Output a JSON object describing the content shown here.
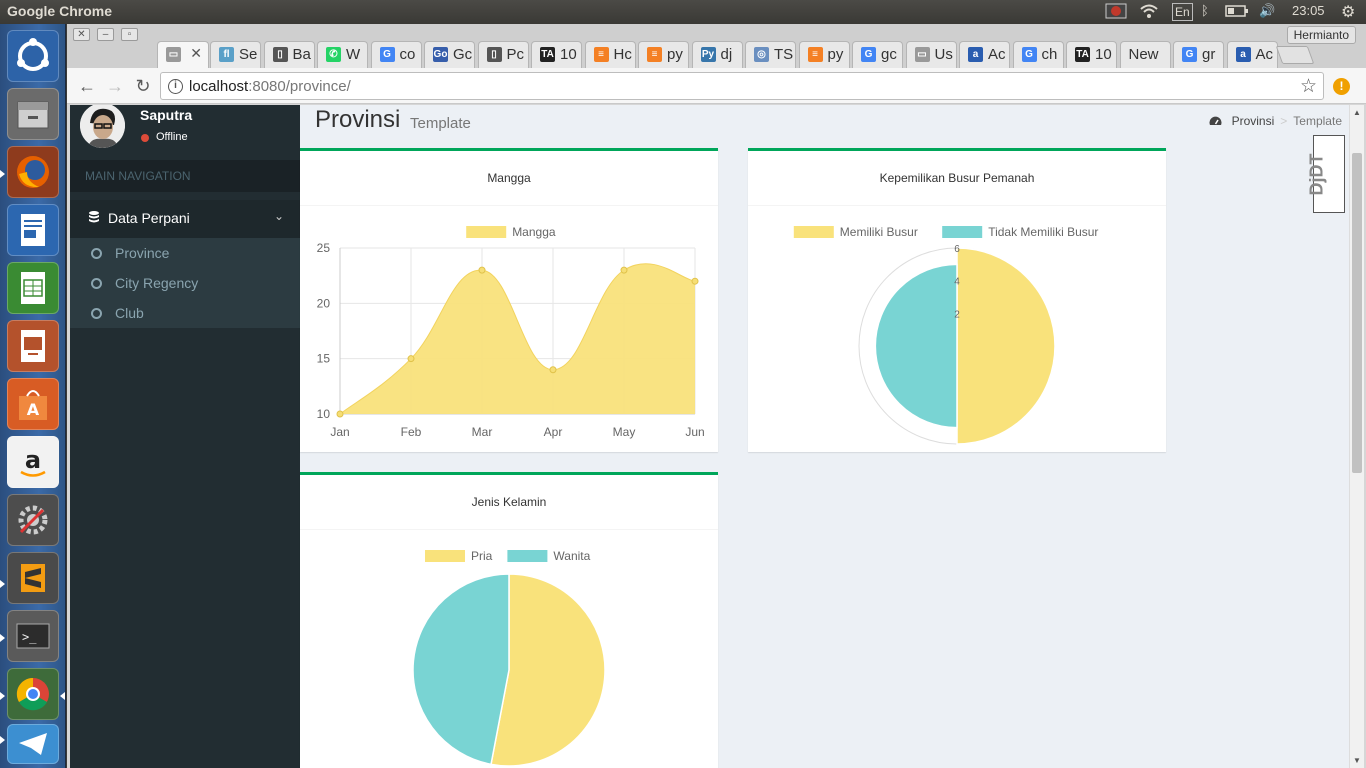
{
  "top_panel": {
    "app_name": "Google Chrome",
    "keyboard": "En",
    "time": "23:05"
  },
  "launcher": {
    "items": [
      "ubuntu-dash-icon",
      "files-icon",
      "firefox-icon",
      "writer-icon",
      "calc-icon",
      "impress-icon",
      "software-center-icon",
      "amazon-icon",
      "system-settings-icon",
      "sublime-icon",
      "terminal-icon",
      "chrome-icon",
      "telegram-icon"
    ]
  },
  "browser": {
    "profile": "Hermianto",
    "tabs": [
      {
        "label": "",
        "icon": "page-icon",
        "active": true
      },
      {
        "label": "Se",
        "icon": "fl-icon"
      },
      {
        "label": "Ba",
        "icon": "book-icon"
      },
      {
        "label": "W",
        "icon": "whatsapp-icon"
      },
      {
        "label": "co",
        "icon": "google-icon"
      },
      {
        "label": "Gc",
        "icon": "go-icon"
      },
      {
        "label": "Pc",
        "icon": "book-icon"
      },
      {
        "label": "10",
        "icon": "ta-icon"
      },
      {
        "label": "Hc",
        "icon": "stackoverflow-icon"
      },
      {
        "label": "py",
        "icon": "stackoverflow-icon"
      },
      {
        "label": "dj",
        "icon": "python-icon"
      },
      {
        "label": "TS",
        "icon": "seal-icon"
      },
      {
        "label": "py",
        "icon": "stackoverflow-icon"
      },
      {
        "label": "gc",
        "icon": "google-icon"
      },
      {
        "label": "Us",
        "icon": "page-icon"
      },
      {
        "label": "Ac",
        "icon": "a-icon"
      },
      {
        "label": "ch",
        "icon": "google-icon"
      },
      {
        "label": "10",
        "icon": "ta-icon"
      },
      {
        "label": "New",
        "icon": ""
      },
      {
        "label": "gr",
        "icon": "google-icon"
      },
      {
        "label": "Ac",
        "icon": "a-icon"
      }
    ],
    "url_host": "localhost",
    "url_rest": ":8080/province/"
  },
  "sidebar": {
    "user_name": "Saputra",
    "user_status": "Offline",
    "nav_header": "MAIN NAVIGATION",
    "menu": {
      "label": "Data Perpani",
      "icon": "database-icon"
    },
    "submenu": [
      "Province",
      "City Regency",
      "Club"
    ]
  },
  "page": {
    "title": "Provinsi",
    "subtitle": "Template",
    "breadcrumb": {
      "root": "Provinsi",
      "current": "Template"
    }
  },
  "colors": {
    "accent": "#00a65a",
    "yellow": "#f9e27b",
    "teal": "#79d4d3"
  },
  "chart_data": [
    {
      "type": "area",
      "title": "Mangga",
      "categories": [
        "Jan",
        "Feb",
        "Mar",
        "Apr",
        "May",
        "Jun"
      ],
      "series": [
        {
          "name": "Mangga",
          "values": [
            10,
            15,
            23,
            14,
            23,
            22
          ]
        }
      ],
      "ylim": [
        10,
        25
      ],
      "yticks": [
        10,
        15,
        20,
        25
      ],
      "grid": true,
      "legend": "top"
    },
    {
      "type": "polarArea",
      "title": "Kepemilikan Busur Pemanah",
      "categories": [
        "Memiliki Busur",
        "Tidak Memiliki Busur"
      ],
      "values": [
        6,
        5
      ],
      "rlim": [
        0,
        6
      ],
      "rticks": [
        2,
        4,
        6
      ],
      "legend": "top"
    },
    {
      "type": "pie",
      "title": "Jenis Kelamin",
      "categories": [
        "Pria",
        "Wanita"
      ],
      "values": [
        53,
        47
      ],
      "legend": "top"
    }
  ]
}
